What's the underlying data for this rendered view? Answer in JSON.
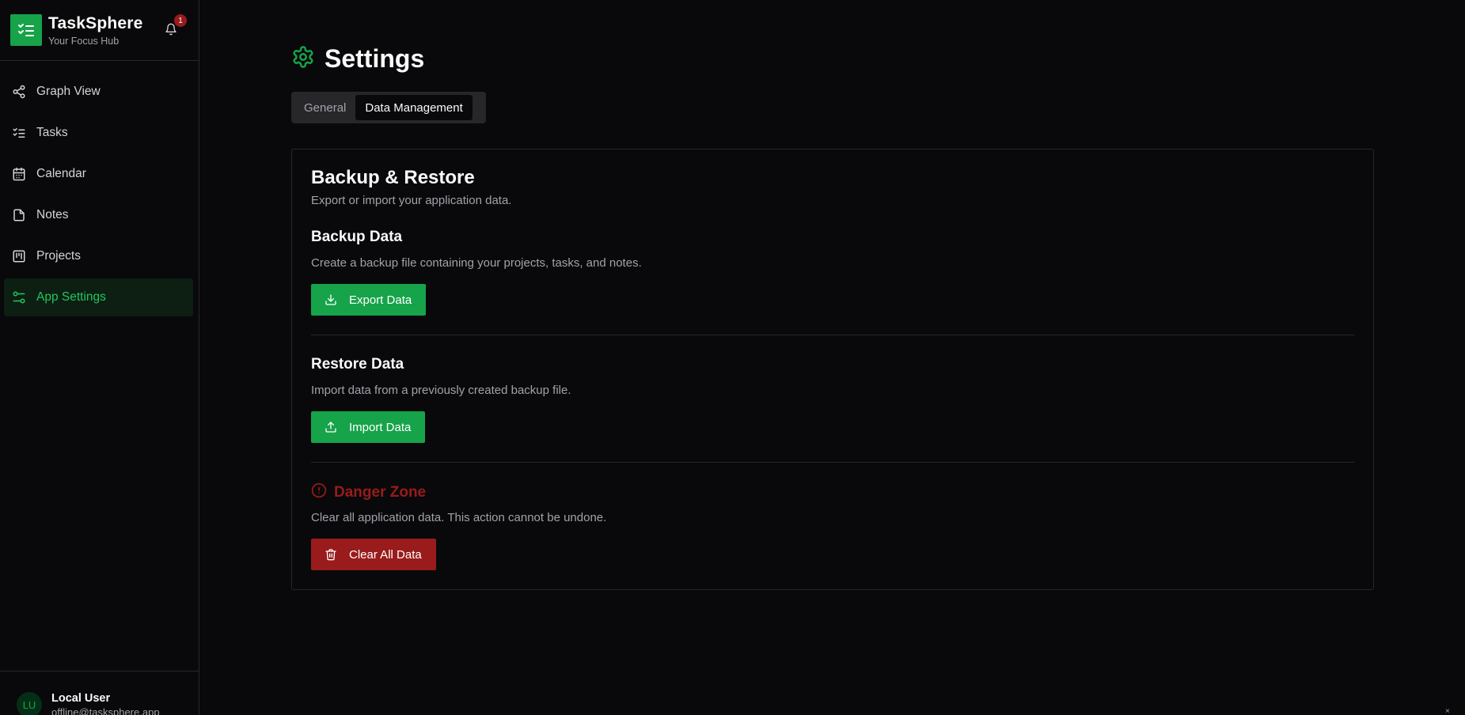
{
  "brand": {
    "name": "TaskSphere",
    "tagline": "Your Focus Hub",
    "notification_count": "1"
  },
  "sidebar": {
    "items": [
      {
        "label": "Graph View",
        "icon": "share-nodes-icon",
        "active": false
      },
      {
        "label": "Tasks",
        "icon": "list-checks-icon",
        "active": false
      },
      {
        "label": "Calendar",
        "icon": "calendar-icon",
        "active": false
      },
      {
        "label": "Notes",
        "icon": "file-icon",
        "active": false
      },
      {
        "label": "Projects",
        "icon": "kanban-icon",
        "active": false
      },
      {
        "label": "App Settings",
        "icon": "sliders-icon",
        "active": true
      }
    ]
  },
  "user": {
    "initials": "LU",
    "name": "Local User",
    "email": "offline@tasksphere.app"
  },
  "page": {
    "title": "Settings",
    "icon": "gear-icon"
  },
  "tabs": [
    {
      "label": "General",
      "active": false
    },
    {
      "label": "Data Management",
      "active": true
    }
  ],
  "card": {
    "title": "Backup & Restore",
    "subtitle": "Export or import your application data.",
    "backup": {
      "title": "Backup Data",
      "description": "Create a backup file containing your projects, tasks, and notes.",
      "button": "Export Data"
    },
    "restore": {
      "title": "Restore Data",
      "description": "Import data from a previously created backup file.",
      "button": "Import Data"
    },
    "danger": {
      "title": "Danger Zone",
      "description": "Clear all application data. This action cannot be undone.",
      "button": "Clear All Data"
    }
  },
  "footer": {
    "close_glyph": "×"
  },
  "colors": {
    "accent": "#16a34a",
    "danger": "#991b1b",
    "background": "#09090b",
    "border": "#27272a"
  }
}
